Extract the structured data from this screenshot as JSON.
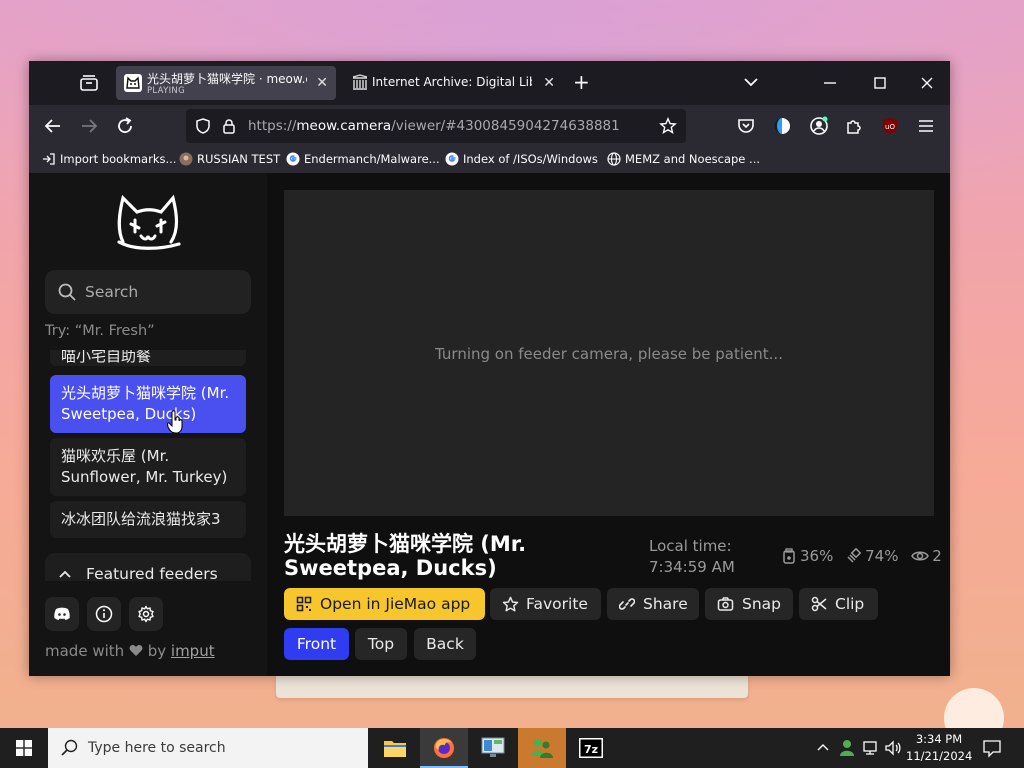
{
  "browser": {
    "tabs": [
      {
        "title": "光头胡萝卜猫咪学院 · meow.camera",
        "subtitle": "PLAYING",
        "active": true
      },
      {
        "title": "Internet Archive: Digital Library of",
        "active": false
      }
    ],
    "url_prefix": "https://",
    "url_domain": "meow.camera",
    "url_path": "/viewer/#4300845904274638881",
    "bookmarks": [
      "Import bookmarks...",
      "RUSSIAN TEST",
      "Endermanch/Malware...",
      "Index of /ISOs/Windows",
      "MEMZ and Noescape ..."
    ]
  },
  "sidebar": {
    "search_placeholder": "Search",
    "try_hint": "Try: “Mr. Fresh”",
    "feeders": [
      {
        "name": "喵小宅自助餐",
        "active": false
      },
      {
        "name": "光头胡萝卜猫咪学院 (Mr. Sweetpea, Ducks)",
        "active": true
      },
      {
        "name": "猫咪欢乐屋 (Mr. Sunflower, Mr. Turkey)",
        "active": false
      },
      {
        "name": "冰冰团队给流浪猫找家3",
        "active": false
      }
    ],
    "featured_label": "Featured feeders",
    "footer_made": "made with",
    "footer_by": "by",
    "footer_link": "imput"
  },
  "viewer": {
    "status_message": "Turning on feeder camera, please be patient...",
    "title": "光头胡萝卜猫咪学院 (Mr. Sweetpea, Ducks)",
    "local_time_label": "Local time:",
    "local_time": "7:34:59 AM",
    "food_level": "36%",
    "battery_level": "74%",
    "viewers": "2",
    "buttons": {
      "open_app": "Open in JieMao app",
      "favorite": "Favorite",
      "share": "Share",
      "snap": "Snap",
      "clip": "Clip"
    },
    "views": [
      "Front",
      "Top",
      "Back"
    ],
    "active_view": "Front"
  },
  "taskbar": {
    "search_placeholder": "Type here to search",
    "time": "3:34 PM",
    "date": "11/21/2024"
  },
  "colors": {
    "accent_blue": "#2f3cf2",
    "active_feeder": "#4a4ff0",
    "open_app_yellow": "#f6c62c"
  }
}
